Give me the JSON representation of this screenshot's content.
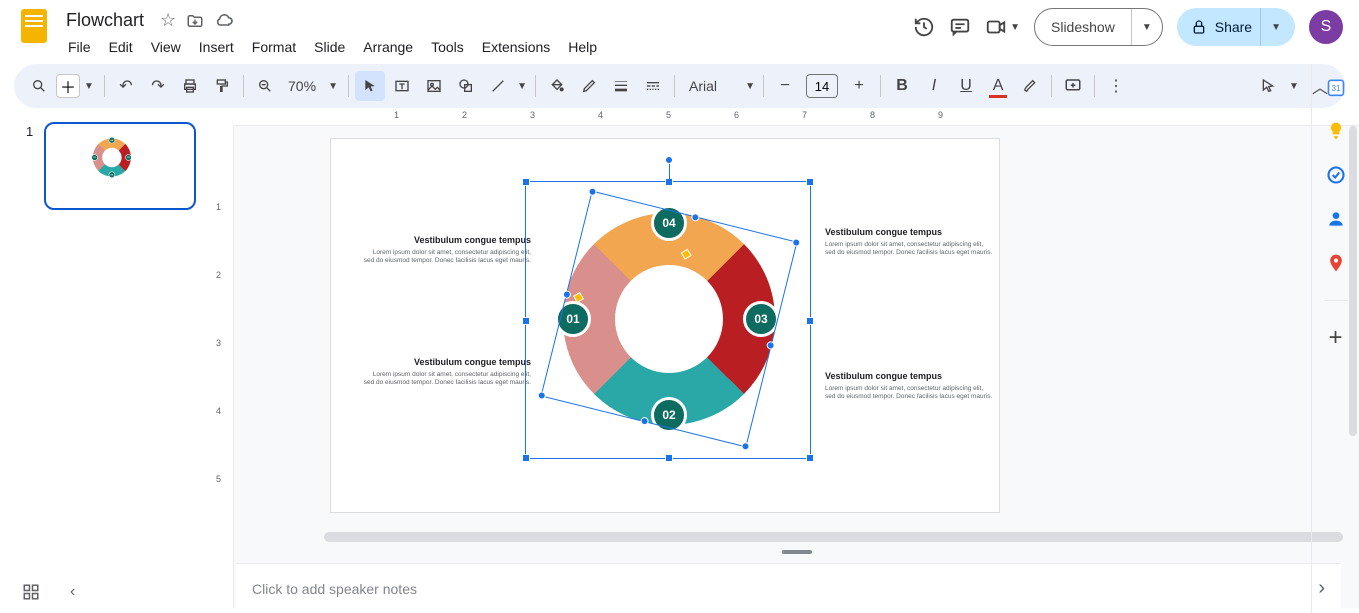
{
  "header": {
    "title": "Flowchart",
    "menus": [
      "File",
      "Edit",
      "View",
      "Insert",
      "Format",
      "Slide",
      "Arrange",
      "Tools",
      "Extensions",
      "Help"
    ],
    "slideshow": "Slideshow",
    "share": "Share",
    "avatar_initial": "S"
  },
  "toolbar": {
    "zoom": "70%",
    "font": "Arial",
    "font_size": "14"
  },
  "slide": {
    "number": "1",
    "donutthumb": {
      "d1": "01",
      "d2": "02",
      "d3": "03",
      "d4": "04"
    },
    "donut": {
      "d1": "01",
      "d2": "02",
      "d3": "03",
      "d4": "04"
    },
    "textblocks": [
      {
        "title": "Vestibulum congue tempus",
        "body": "Lorem ipsum dolor sit amet, consectetur adipiscing elit, sed do eiusmod tempor. Donec facilisis lacus eget mauris."
      },
      {
        "title": "Vestibulum congue tempus",
        "body": "Lorem ipsum dolor sit amet, consectetur adipiscing elit, sed do eiusmod tempor. Donec facilisis lacus eget mauris."
      },
      {
        "title": "Vestibulum congue tempus",
        "body": "Lorem ipsum dolor sit amet, consectetur adipiscing elit, sed do eiusmod tempor. Donec facilisis lacus eget mauris."
      },
      {
        "title": "Vestibulum congue tempus",
        "body": "Lorem ipsum dolor sit amet, consectetur adipiscing elit, sed do eiusmod tempor. Donec facilisis lacus eget mauris."
      }
    ]
  },
  "notes": {
    "placeholder": "Click to add speaker notes"
  },
  "ruler_h": [
    "1",
    "2",
    "3",
    "4",
    "5",
    "6",
    "7",
    "8",
    "9"
  ],
  "ruler_v": [
    "1",
    "2",
    "3",
    "4",
    "5"
  ]
}
